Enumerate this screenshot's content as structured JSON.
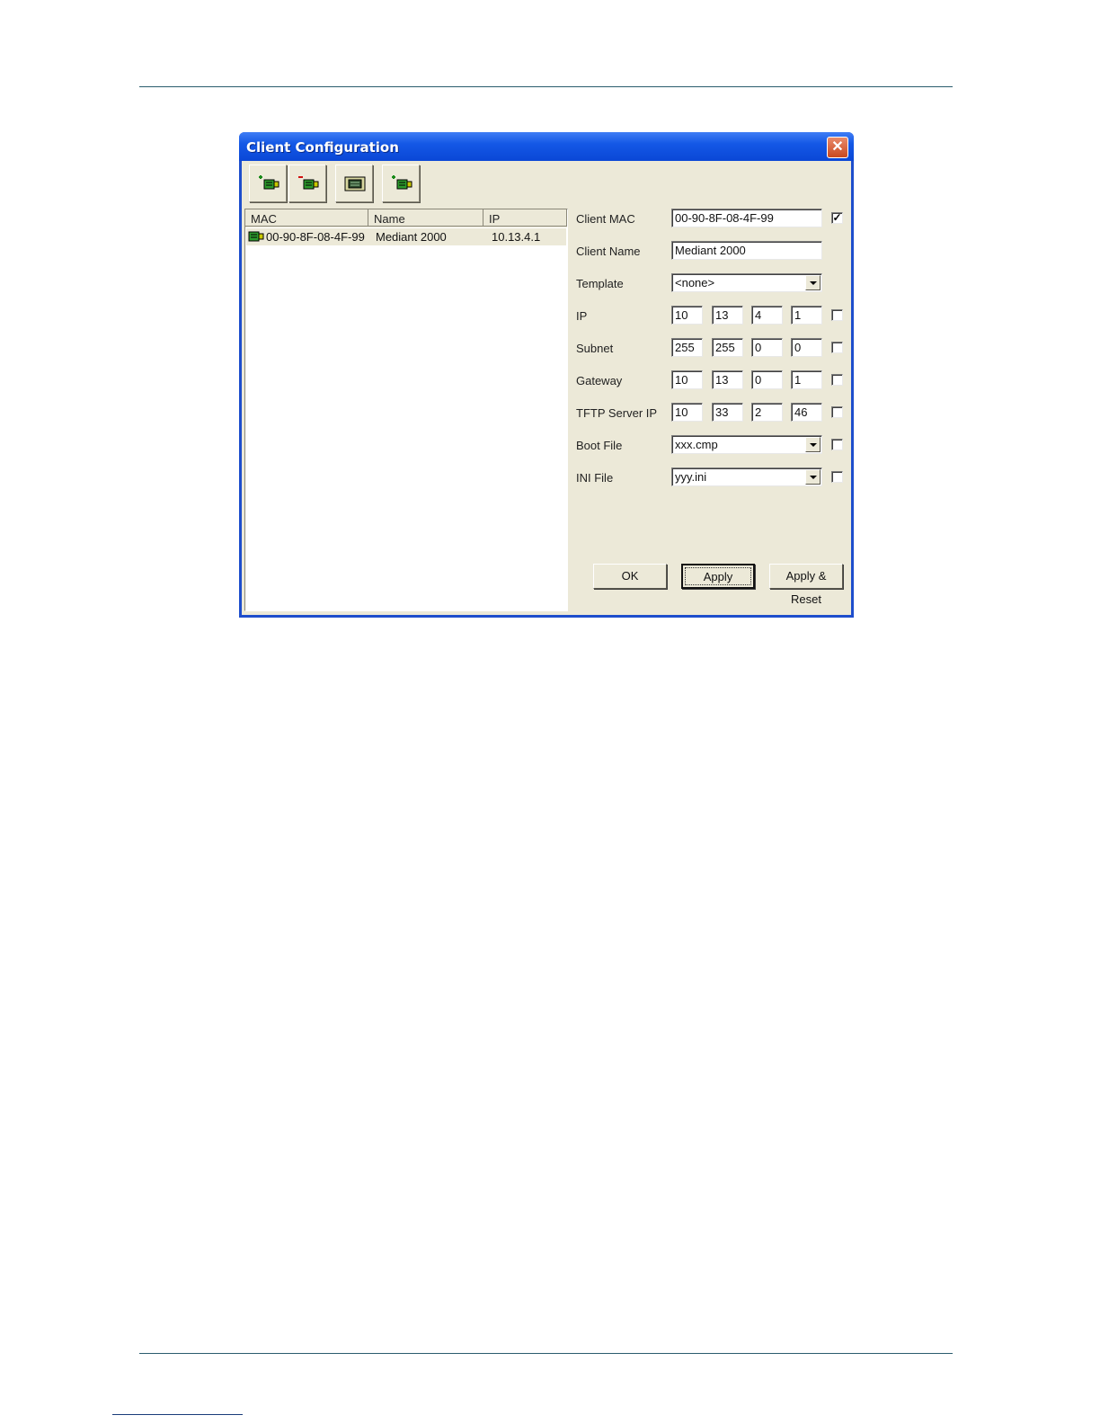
{
  "window": {
    "title": "Client Configuration"
  },
  "toolbar": {
    "icons": [
      "add-client-icon",
      "remove-client-icon",
      "template-icon",
      "apply-client-icon"
    ]
  },
  "list": {
    "columns": [
      "MAC",
      "Name",
      "IP"
    ],
    "rows": [
      {
        "mac": "00-90-8F-08-4F-99",
        "name": "Mediant 2000",
        "ip": "10.13.4.1"
      }
    ]
  },
  "form": {
    "client_mac": {
      "label": "Client MAC",
      "value": "00-90-8F-08-4F-99",
      "checked": true
    },
    "client_name": {
      "label": "Client Name",
      "value": "Mediant 2000"
    },
    "template": {
      "label": "Template",
      "value": "<none>"
    },
    "ip": {
      "label": "IP",
      "octets": [
        "10",
        "13",
        "4",
        "1"
      ],
      "checked": false
    },
    "subnet": {
      "label": "Subnet",
      "octets": [
        "255",
        "255",
        "0",
        "0"
      ],
      "checked": false
    },
    "gateway": {
      "label": "Gateway",
      "octets": [
        "10",
        "13",
        "0",
        "1"
      ],
      "checked": false
    },
    "tftp": {
      "label": "TFTP Server IP",
      "octets": [
        "10",
        "33",
        "2",
        "46"
      ],
      "checked": false
    },
    "boot_file": {
      "label": "Boot File",
      "value": "xxx.cmp",
      "checked": false
    },
    "ini_file": {
      "label": "INI File",
      "value": "yyy.ini",
      "checked": false
    }
  },
  "buttons": {
    "ok": "OK",
    "apply": "Apply",
    "apply_reset": "Apply & Reset"
  },
  "colors": {
    "titlebar": "#0a47d6",
    "face": "#ece9d8",
    "close": "#c9481f"
  }
}
